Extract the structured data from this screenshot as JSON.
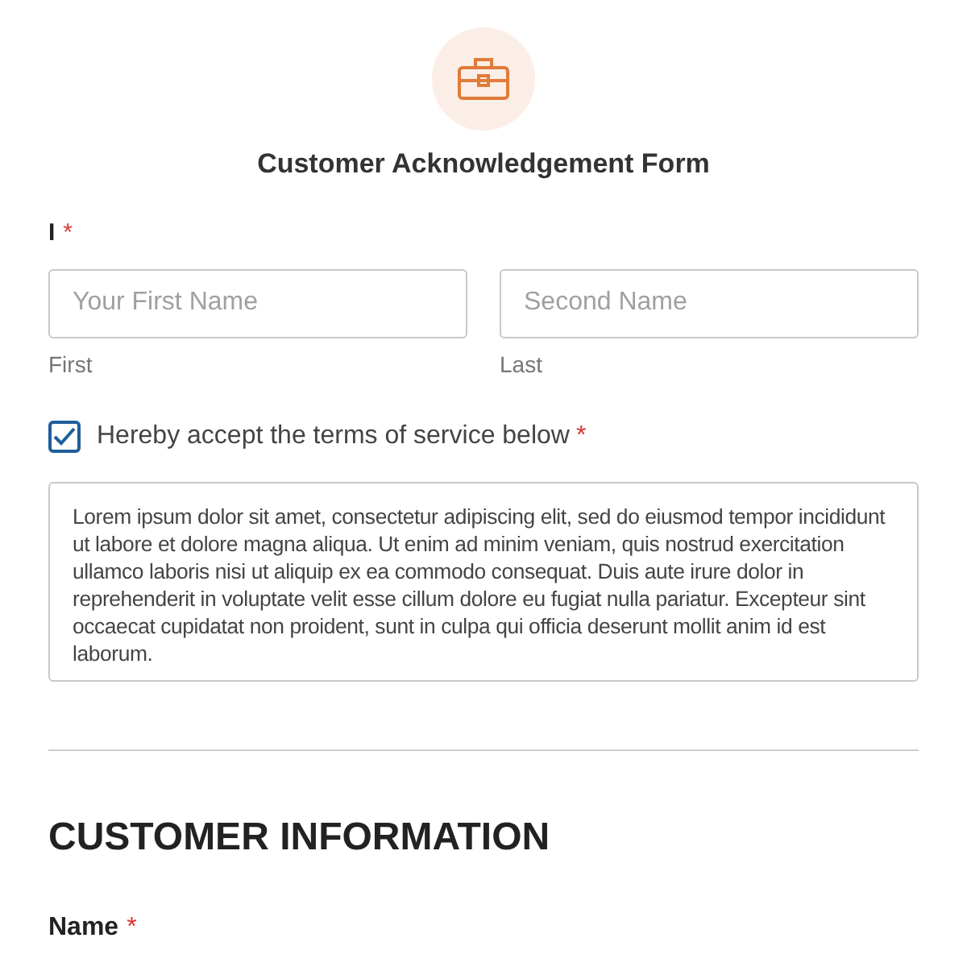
{
  "form": {
    "title": "Customer Acknowledgement Form"
  },
  "name_field": {
    "label": "I",
    "required_mark": "*",
    "inputs": [
      {
        "placeholder": "Your First Name",
        "sublabel": "First"
      },
      {
        "placeholder": "Second Name",
        "sublabel": "Last"
      }
    ]
  },
  "terms": {
    "checked": true,
    "label": "Hereby accept the terms of service below",
    "required_mark": "*",
    "text": "Lorem ipsum dolor sit amet, consectetur adipiscing elit, sed do eiusmod tempor incididunt ut labore et dolore magna aliqua. Ut enim ad minim veniam, quis nostrud exercitation ullamco laboris nisi ut aliquip ex ea commodo consequat. Duis aute irure dolor in reprehenderit in voluptate velit esse cillum dolore eu fugiat nulla pariatur. Excepteur sint occaecat cupidatat non proident, sunt in culpa qui officia deserunt mollit anim id est laborum."
  },
  "section": {
    "heading": "CUSTOMER INFORMATION",
    "field_label": "Name",
    "required_mark": "*"
  }
}
